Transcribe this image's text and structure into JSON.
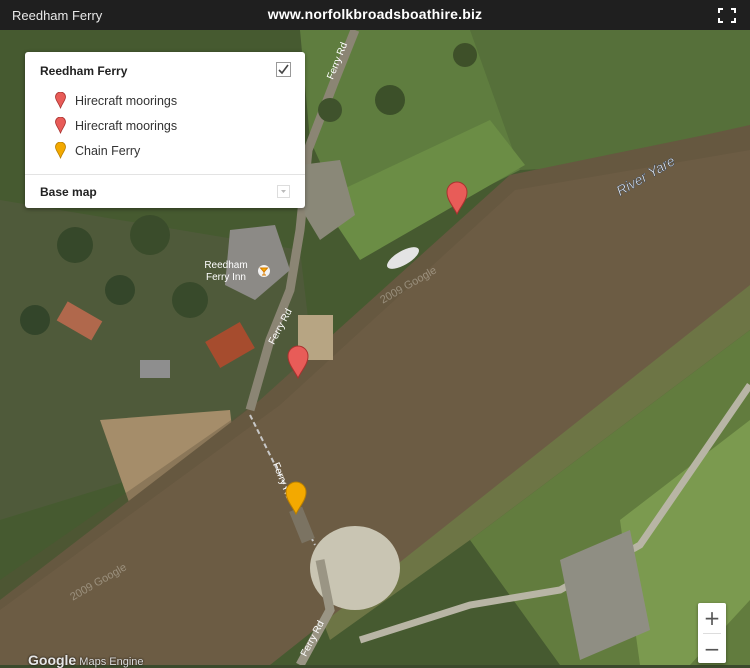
{
  "topbar": {
    "title": "Reedham Ferry",
    "site": "www.norfolkbroadsboathire.biz",
    "fullscreen_icon": "fullscreen-icon"
  },
  "legend": {
    "title": "Reedham Ferry",
    "checked": true,
    "items": [
      {
        "label": "Hirecraft moorings",
        "icon": "red-pin-icon",
        "color": "#e85c58"
      },
      {
        "label": "Hirecraft moorings",
        "icon": "red-pin-icon",
        "color": "#e85c58"
      },
      {
        "label": "Chain Ferry",
        "icon": "yellow-pin-icon",
        "color": "#f3a900"
      }
    ],
    "base_map_label": "Base map"
  },
  "map": {
    "labels": {
      "river": "River Yare",
      "road1": "Ferry Rd",
      "road2": "Ferry Rd",
      "road3": "Ferry Rd",
      "road4": "Ferry Rd",
      "inn": "Reedham\nFerry Inn",
      "watermark": "2009 Google"
    },
    "markers": [
      {
        "name": "Hirecraft moorings",
        "color": "#e85c58"
      },
      {
        "name": "Hirecraft moorings",
        "color": "#e85c58"
      },
      {
        "name": "Chain Ferry",
        "color": "#f3a900"
      }
    ]
  },
  "zoom": {
    "plus": "+",
    "minus": "−"
  },
  "footer": {
    "brand": "Google",
    "text": "Maps Engine"
  }
}
